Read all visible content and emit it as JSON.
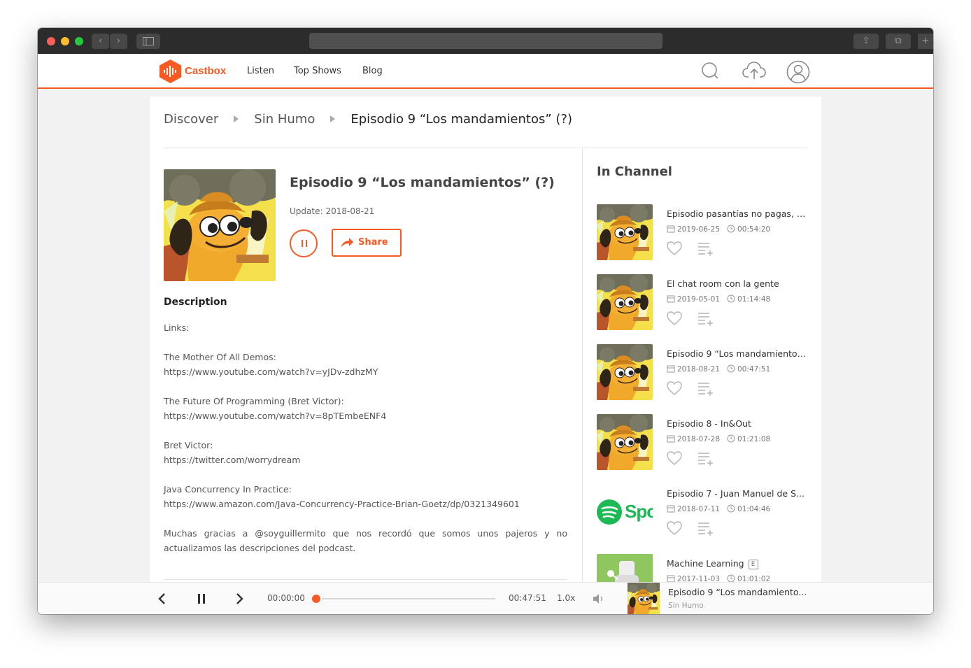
{
  "colors": {
    "accent": "#f55b23",
    "spotify": "#1db954"
  },
  "nav": {
    "brand": "Castbox",
    "links": [
      "Listen",
      "Top Shows",
      "Blog"
    ],
    "icons": [
      "search-icon",
      "upload-icon",
      "account-icon"
    ]
  },
  "breadcrumb": [
    "Discover",
    "Sin Humo",
    "Episodio 9 “Los mandamientos” (?)"
  ],
  "episode": {
    "title": "Episodio 9 “Los mandamientos” (?)",
    "update_label": "Update:",
    "update_date": "2018-08-21",
    "share_label": "Share"
  },
  "description": {
    "heading": "Description",
    "lines": [
      "Links:",
      "",
      "The Mother Of All Demos:",
      "https://www.youtube.com/watch?v=yJDv-zdhzMY",
      "",
      "The Future Of Programming (Bret Victor):",
      "https://www.youtube.com/watch?v=8pTEmbeENF4",
      "",
      "Bret Victor:",
      "https://twitter.com/worrydream",
      "",
      "Java Concurrency In Practice:",
      "https://www.amazon.com/Java-Concurrency-Practice-Brian-Goetz/dp/0321349601",
      "",
      "Muchas gracias a @soyguillermito que nos recordó que somos unos pajeros y no actualizamos las descripciones del podcast."
    ]
  },
  "channel": {
    "heading": "In Channel",
    "items": [
      {
        "title": "Episodio pasantías no pagas, t...",
        "date": "2019-06-25",
        "duration": "00:54:20",
        "thumb": "dog"
      },
      {
        "title": "El chat room con la gente",
        "date": "2019-05-01",
        "duration": "01:14:48",
        "thumb": "dog"
      },
      {
        "title": "Episodio 9 “Los mandamientos...",
        "date": "2018-08-21",
        "duration": "00:47:51",
        "thumb": "dog"
      },
      {
        "title": "Episodio 8 - In&Out",
        "date": "2018-07-28",
        "duration": "01:21:08",
        "thumb": "dog"
      },
      {
        "title": "Episodio 7 - Juan Manuel de S...",
        "date": "2018-07-11",
        "duration": "01:04:46",
        "thumb": "spotify",
        "thumb_text": "Spo"
      },
      {
        "title": "Machine Learning",
        "badge": "E",
        "date": "2017-11-03",
        "duration": "01:01:02",
        "thumb": "robot"
      }
    ]
  },
  "player": {
    "current_time": "00:00:00",
    "total_time": "00:47:51",
    "progress": 0,
    "speed": "1.0x",
    "now_playing_title": "Episodio 9 “Los mandamiento...",
    "now_playing_show": "Sin Humo"
  }
}
